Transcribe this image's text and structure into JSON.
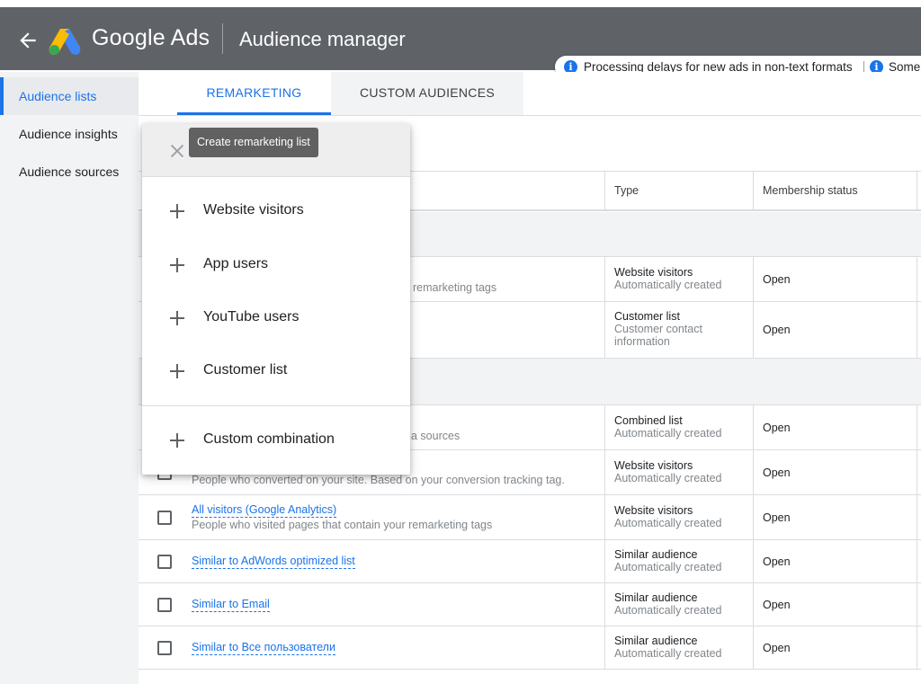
{
  "header": {
    "brand": "Google Ads",
    "title": "Audience manager",
    "notices": [
      "Processing delays for new ads in non-text formats",
      "Some"
    ]
  },
  "colors": {
    "header_bg": "#5f6368",
    "accent": "#1a73e8",
    "sidebar_bg": "#f1f3f4"
  },
  "sidebar": {
    "items": [
      {
        "label": "Audience lists",
        "active": true
      },
      {
        "label": "Audience insights",
        "active": false
      },
      {
        "label": "Audience sources",
        "active": false
      }
    ]
  },
  "tabs": [
    {
      "label": "REMARKETING",
      "active": true
    },
    {
      "label": "CUSTOM AUDIENCES",
      "active": false
    }
  ],
  "table": {
    "columns": [
      "Type",
      "Membership status"
    ],
    "rows": [
      {
        "desc": "remarketing tags",
        "type": "Website visitors",
        "type_sub": "Automatically created",
        "status": "Open"
      },
      {
        "type": "Customer list",
        "type_sub": "Customer contact information",
        "status": "Open"
      },
      {
        "desc": "a sources",
        "type": "Combined list",
        "type_sub": "Automatically created",
        "status": "Open"
      },
      {
        "desc": "People who converted on your site. Based on your conversion tracking tag.",
        "type": "Website visitors",
        "type_sub": "Automatically created",
        "status": "Open"
      },
      {
        "name": "All visitors (Google Analytics)",
        "desc": "People who visited pages that contain your remarketing tags",
        "type": "Website visitors",
        "type_sub": "Automatically created",
        "status": "Open"
      },
      {
        "name": "Similar to AdWords optimized list",
        "type": "Similar audience",
        "type_sub": "Automatically created",
        "status": "Open"
      },
      {
        "name": "Similar to Email",
        "type": "Similar audience",
        "type_sub": "Automatically created",
        "status": "Open"
      },
      {
        "name": "Similar to Все пользователи",
        "type": "Similar audience",
        "type_sub": "Automatically created",
        "status": "Open"
      }
    ]
  },
  "menu": {
    "tooltip": "Create remarketing list",
    "items": [
      "Website visitors",
      "App users",
      "YouTube users",
      "Customer list",
      "Custom combination"
    ],
    "icons": {
      "close": "close-icon",
      "add": "plus-icon"
    }
  }
}
